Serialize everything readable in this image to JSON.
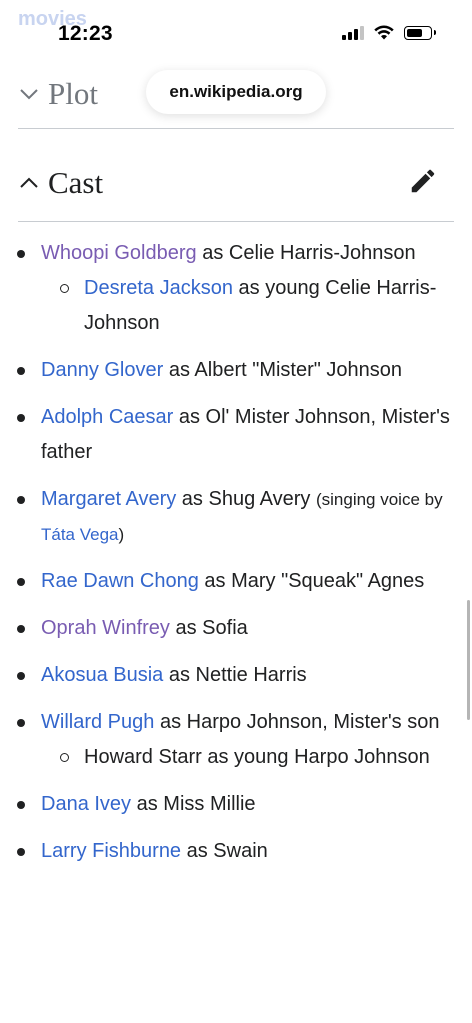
{
  "behind_header_text": "movies",
  "status": {
    "time": "12:23",
    "battery_level": 0.7
  },
  "url": "en.wikipedia.org",
  "sections": {
    "plot": "Plot",
    "cast": "Cast"
  },
  "cast": [
    {
      "actor": "Whoopi Goldberg",
      "role": " as Celie Harris-Johnson",
      "visited": true,
      "sub": [
        {
          "actor": "Desreta Jackson",
          "role": " as young Celie Harris-Johnson"
        }
      ]
    },
    {
      "actor": "Danny Glover",
      "role": " as Albert \"Mister\" Johnson"
    },
    {
      "actor": "Adolph Caesar",
      "role": " as Ol' Mister Johnson, Mister's father"
    },
    {
      "actor": "Margaret Avery",
      "role": " as Shug Avery ",
      "note_pre": "(singing voice by ",
      "note_link": "Táta Vega",
      "note_post": ")"
    },
    {
      "actor": "Rae Dawn Chong",
      "role": " as Mary \"Squeak\" Agnes"
    },
    {
      "actor": "Oprah Winfrey",
      "role": " as Sofia",
      "visited": true
    },
    {
      "actor": "Akosua Busia",
      "role": " as Nettie Harris"
    },
    {
      "actor": "Willard Pugh",
      "role": " as Harpo Johnson, Mister's son",
      "sub": [
        {
          "text": "Howard Starr as young Harpo Johnson"
        }
      ]
    },
    {
      "actor": "Dana Ivey",
      "role": " as Miss Millie"
    },
    {
      "actor": "Larry Fishburne",
      "role": " as Swain"
    }
  ]
}
